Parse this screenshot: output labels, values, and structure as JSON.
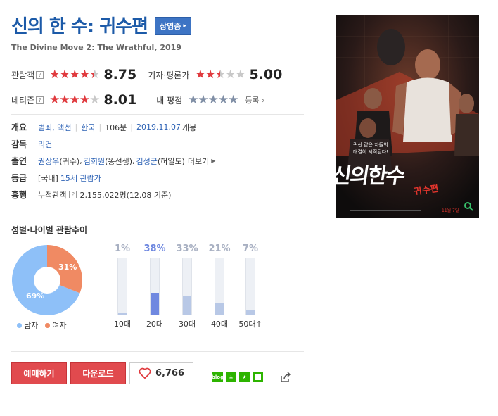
{
  "movie": {
    "title": "신의 한 수: 귀수편",
    "status_badge": "상영중",
    "subtitle": "The Divine Move 2: The Wrathful, 2019"
  },
  "ratings": {
    "audience": {
      "label": "관람객",
      "score": "8.75",
      "stars": 4.5
    },
    "critic": {
      "label": "기자·평론가",
      "score": "5.00",
      "stars": 2.5
    },
    "netizen": {
      "label": "네티즌",
      "score": "8.01",
      "stars": 4
    },
    "my_rating": {
      "label": "내 평점",
      "stars": 0,
      "register": "등록"
    }
  },
  "info": {
    "overview_label": "개요",
    "genre": "범죄, 액션",
    "country": "한국",
    "runtime": "106분",
    "release": "2019.11.07",
    "release_suffix": "개봉",
    "director_label": "감독",
    "director": "리건",
    "cast_label": "출연",
    "cast": [
      {
        "name": "권상우",
        "role": "(귀수)"
      },
      {
        "name": "김희원",
        "role": "(똥선생)"
      },
      {
        "name": "김성균",
        "role": "(허일도)"
      }
    ],
    "cast_more": "더보기",
    "grade_label": "등급",
    "grade_prefix": "[국내]",
    "grade": "15세 관람가",
    "boxoffice_label": "흥행",
    "boxoffice_text": "누적관객",
    "boxoffice_value": "2,155,022명",
    "boxoffice_date": "(12.08 기준)"
  },
  "audience_trend": {
    "title": "성별·나이별 관람추이",
    "gender": {
      "male_label": "남자",
      "male_pct": "69%",
      "male_value": 69,
      "female_label": "여자",
      "female_pct": "31%",
      "female_value": 31,
      "male_color": "#8ec0f8",
      "female_color": "#f08a63"
    },
    "ages": [
      {
        "label": "10대",
        "pct": "1%",
        "value": 1
      },
      {
        "label": "20대",
        "pct": "38%",
        "value": 38,
        "highlight": true
      },
      {
        "label": "30대",
        "pct": "33%",
        "value": 33
      },
      {
        "label": "40대",
        "pct": "21%",
        "value": 21
      },
      {
        "label": "50대↑",
        "pct": "7%",
        "value": 7
      }
    ]
  },
  "actions": {
    "reserve": "예매하기",
    "download": "다운로드",
    "likes": "6,766"
  },
  "poster": {
    "tagline_line1": "귀신 같은 자들의",
    "tagline_line2": "대결이 시작된다!",
    "title": "신의한수",
    "subtitle": "귀수편",
    "release_date": "11월 7일"
  },
  "colors": {
    "title": "#1c5aa8",
    "star_on": "#e03a3e",
    "red_button": "#e14a4e",
    "age_highlight": "#6f88e0"
  }
}
